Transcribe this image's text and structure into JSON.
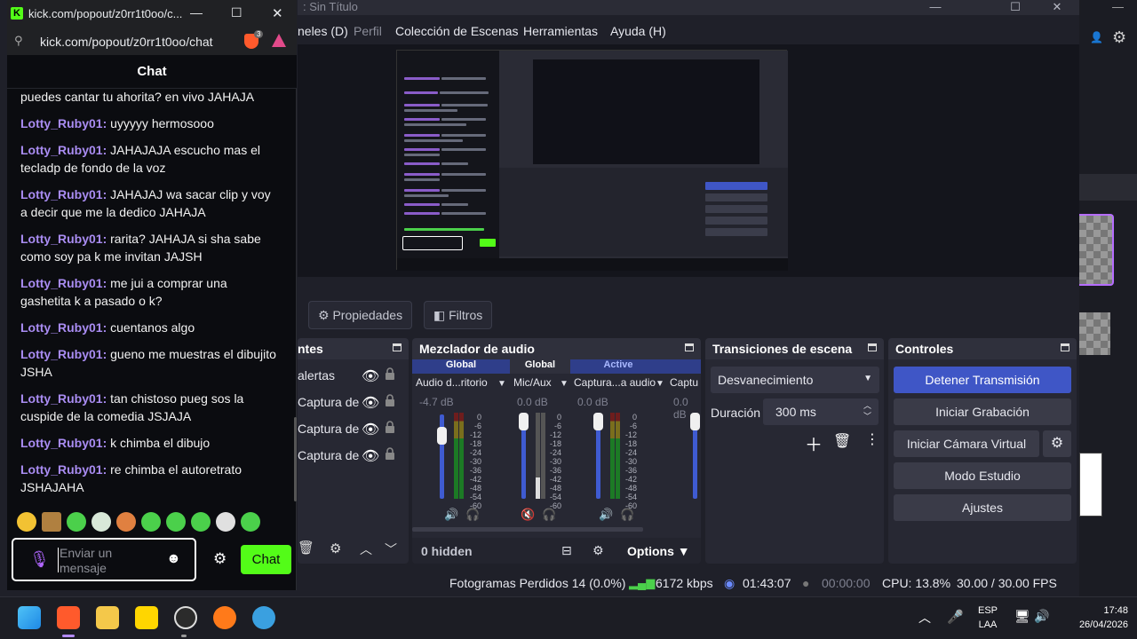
{
  "obs": {
    "window_title": ": Sin Título",
    "menu": [
      "neles (D)",
      "Perfil",
      "Colección de Escenas",
      "Herramientas",
      "Ayuda (H)"
    ],
    "toolbar": {
      "properties": "Propiedades",
      "filters": "Filtros"
    },
    "docks": {
      "sources": {
        "title": "ntes",
        "items": [
          {
            "label": "alertas"
          },
          {
            "label": "Captura de"
          },
          {
            "label": "Captura de"
          },
          {
            "label": "Captura de"
          }
        ]
      },
      "mixer": {
        "title": "Mezclador de audio",
        "channels": [
          {
            "tag": "Global",
            "name": "Audio d...ritorio",
            "db": "-4.7 dB",
            "level": 0.58,
            "muted": false
          },
          {
            "tag": "Global",
            "name": "Mic/Aux",
            "db": "0.0 dB",
            "level": 0.25,
            "muted": true
          },
          {
            "tag": "Active",
            "name": "Captura...a audio",
            "db": "0.0 dB",
            "level": 0.8,
            "muted": false
          },
          {
            "tag": "",
            "name": "Captu",
            "db": "0.0 dB",
            "level": 0.0,
            "muted": false
          }
        ],
        "scale": [
          "0",
          "-6",
          "-12",
          "-18",
          "-24",
          "-30",
          "-36",
          "-42",
          "-48",
          "-54",
          "-60"
        ],
        "hidden": "0 hidden",
        "options": "Options"
      },
      "transitions": {
        "title": "Transiciones de escena",
        "selected": "Desvanecimiento",
        "duration_label": "Duración",
        "duration": "300 ms"
      },
      "controls": {
        "title": "Controles",
        "buttons": [
          "Detener Transmisión",
          "Iniciar Grabación",
          "Iniciar Cámara Virtual",
          "Modo Estudio",
          "Ajustes"
        ]
      }
    },
    "status": {
      "dropped": "Fotogramas Perdidos 14 (0.0%)",
      "bitrate": "6172 kbps",
      "stream_time": "01:43:07",
      "rec_time": "00:00:00",
      "cpu": "CPU: 13.8%",
      "fps": "30.00 / 30.00 FPS"
    }
  },
  "browser": {
    "tab_title": "kick.com/popout/z0rr1t0oo/c...",
    "address": "kick.com/popout/z0rr1t0oo/chat",
    "shield_count": "3"
  },
  "chat": {
    "header": "Chat",
    "messages": [
      {
        "user": "",
        "text": "puedes cantar tu ahorita? en vivo JAHAJA"
      },
      {
        "user": "Lotty_Ruby01",
        "text": "uyyyyy hermosooo"
      },
      {
        "user": "Lotty_Ruby01",
        "text": "JAHAJAJA escucho mas el tecladp de fondo de la voz"
      },
      {
        "user": "Lotty_Ruby01",
        "text": "JAHAJAJ wa sacar clip y voy a decir que me la dedico JAHAJA"
      },
      {
        "user": "Lotty_Ruby01",
        "text": "rarita? JAHAJA si sha sabe como soy pa k me invitan JAJSH"
      },
      {
        "user": "Lotty_Ruby01",
        "text": "me jui a comprar una gashetita k a pasado o k?"
      },
      {
        "user": "Lotty_Ruby01",
        "text": "cuentanos algo"
      },
      {
        "user": "Lotty_Ruby01",
        "text": "gueno me muestras el dibujito JSHA"
      },
      {
        "user": "Lotty_Ruby01",
        "text": "tan chistoso pueg sos la cuspide de la comedia JSJAJA"
      },
      {
        "user": "Lotty_Ruby01",
        "text": "k chimba el dibujo"
      },
      {
        "user": "Lotty_Ruby01",
        "text": "re chimba el autoretrato JSHAJAHA"
      }
    ],
    "input_placeholder": "Enviar un mensaje",
    "send_label": "Chat"
  },
  "taskbar": {
    "language": "ESP",
    "layout": "LAA",
    "time": "17:48",
    "date": "26/04/2026"
  },
  "colors": {
    "kick_green": "#53fc18",
    "username": "#a98cf2",
    "obs_blue": "#3f56c6"
  }
}
